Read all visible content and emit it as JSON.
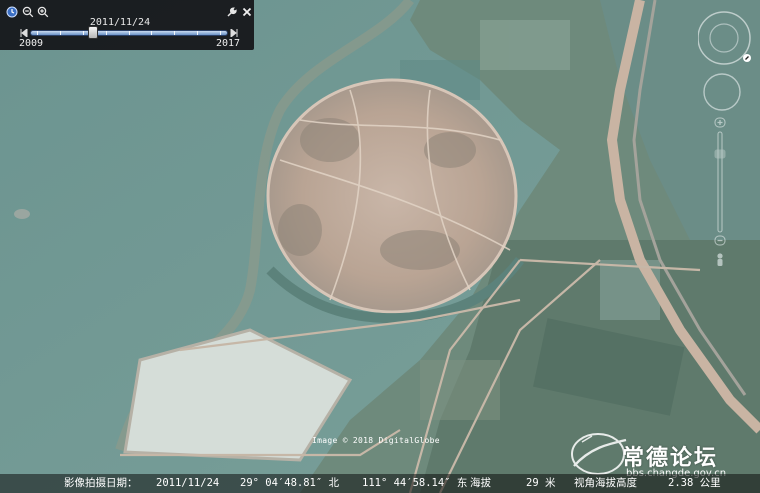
{
  "time_slider": {
    "current_date": "2011/11/24",
    "start_year": "2009",
    "end_year": "2017",
    "position_fraction": 0.32
  },
  "toolbar_icons": [
    "clock-icon",
    "zoom-out-icon",
    "zoom-in-icon",
    "wrench-icon",
    "close-icon"
  ],
  "watermark": {
    "imagery_credit": "Image © 2018 DigitalGlobe",
    "forum_name": "常德论坛",
    "forum_url": "bbs.changde.gov.cn"
  },
  "status_bar": {
    "capture_date_label": "影像拍摄日期：",
    "capture_date": "2011/11/24",
    "latitude": "29° 04′48.81″ 北",
    "longitude": "111° 44′58.14″ 东",
    "elevation_label": "海拔",
    "elevation": "29 米",
    "eye_alt_label": "视角海拔高度",
    "eye_alt": "2.38 公里"
  },
  "colors": {
    "water": "#6f9590",
    "land": "#b8a89b",
    "panel": "#141418"
  }
}
